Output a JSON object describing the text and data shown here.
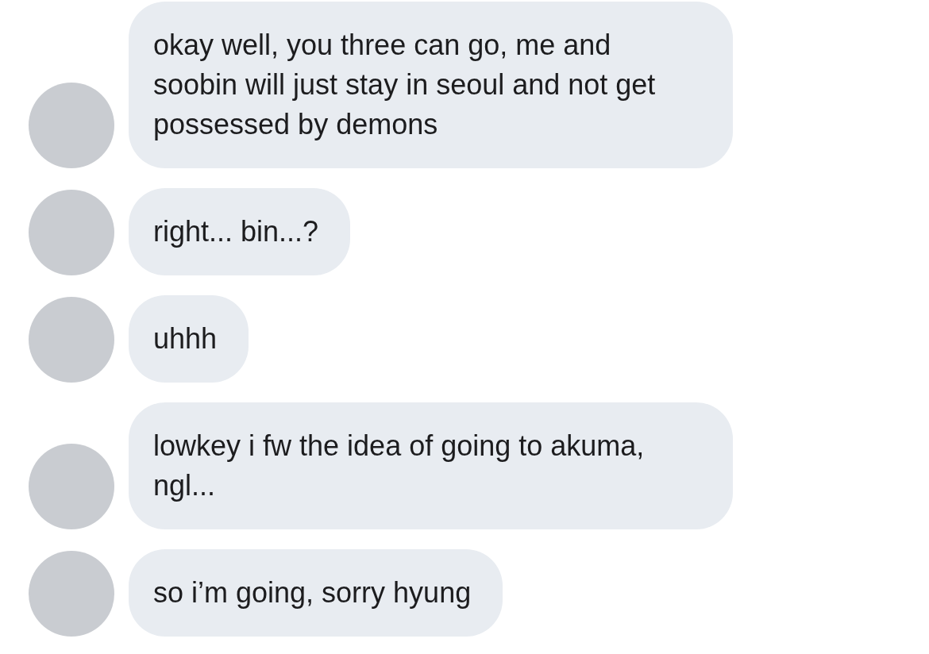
{
  "messages": [
    {
      "text": "okay well, you three can go, me and soobin will just stay in seoul and not get possessed by demons"
    },
    {
      "text": "right... bin...?"
    },
    {
      "text": "uhhh"
    },
    {
      "text": "lowkey i fw the idea of going to akuma, ngl..."
    },
    {
      "text": "so i’m going, sorry hyung"
    }
  ]
}
